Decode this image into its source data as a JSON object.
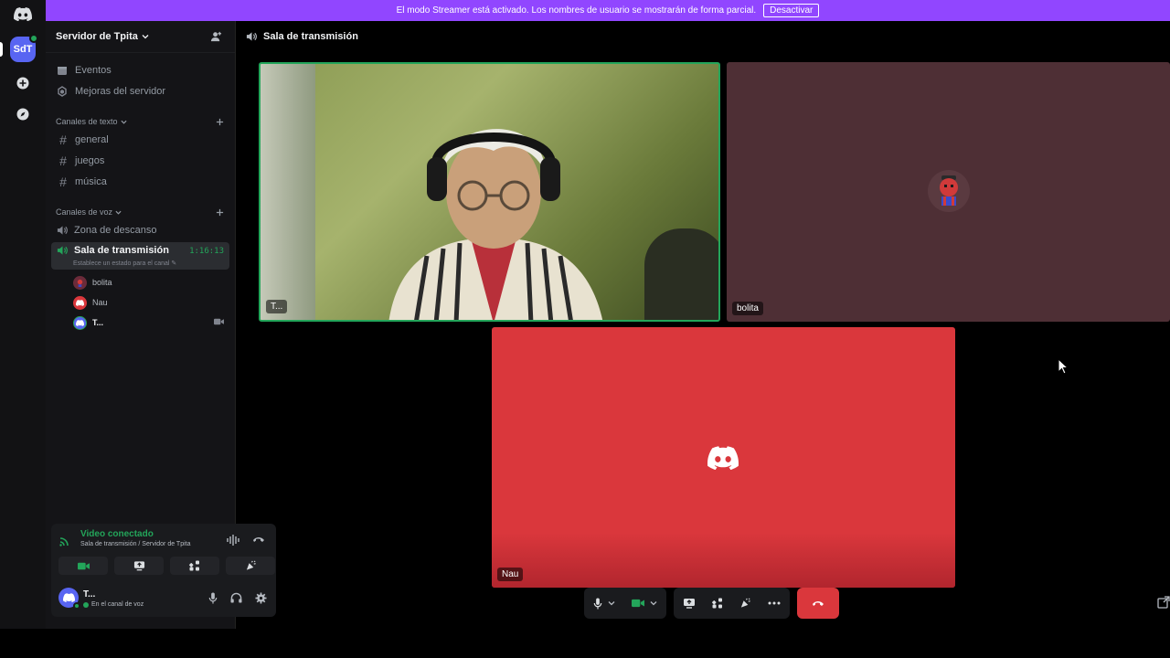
{
  "banner": {
    "text": "El modo Streamer está activado. Los nombres de usuario se mostrarán de forma parcial.",
    "button": "Desactivar"
  },
  "rail": {
    "server_abbr": "SdT"
  },
  "sidebar": {
    "server_name": "Servidor de Tpita",
    "nav": [
      {
        "label": "Eventos",
        "icon": "calendar-icon"
      },
      {
        "label": "Mejoras del servidor",
        "icon": "boost-icon"
      }
    ],
    "text_category": "Canales de texto",
    "text_channels": [
      "general",
      "juegos",
      "música"
    ],
    "voice_category": "Canales de voz",
    "voice_channels": {
      "idle": "Zona de descanso",
      "active": "Sala de transmisión",
      "timer": "1:16:13",
      "status_hint": "Establece un estado para el canal"
    },
    "members": [
      "bolita",
      "Nau",
      "T..."
    ]
  },
  "voice_panel": {
    "title": "Video conectado",
    "subtitle": "Sala de transmisión / Servidor de Tpita"
  },
  "user_panel": {
    "name": "T...",
    "status": "En el canal de voz"
  },
  "main": {
    "channel_title": "Sala de transmisión",
    "tiles": [
      {
        "label": "T..."
      },
      {
        "label": "bolita"
      },
      {
        "label": "Nau"
      }
    ]
  },
  "colors": {
    "accent": "#5865f2",
    "online": "#23a55a",
    "danger": "#da373c",
    "streamer_banner": "#9146ff"
  }
}
